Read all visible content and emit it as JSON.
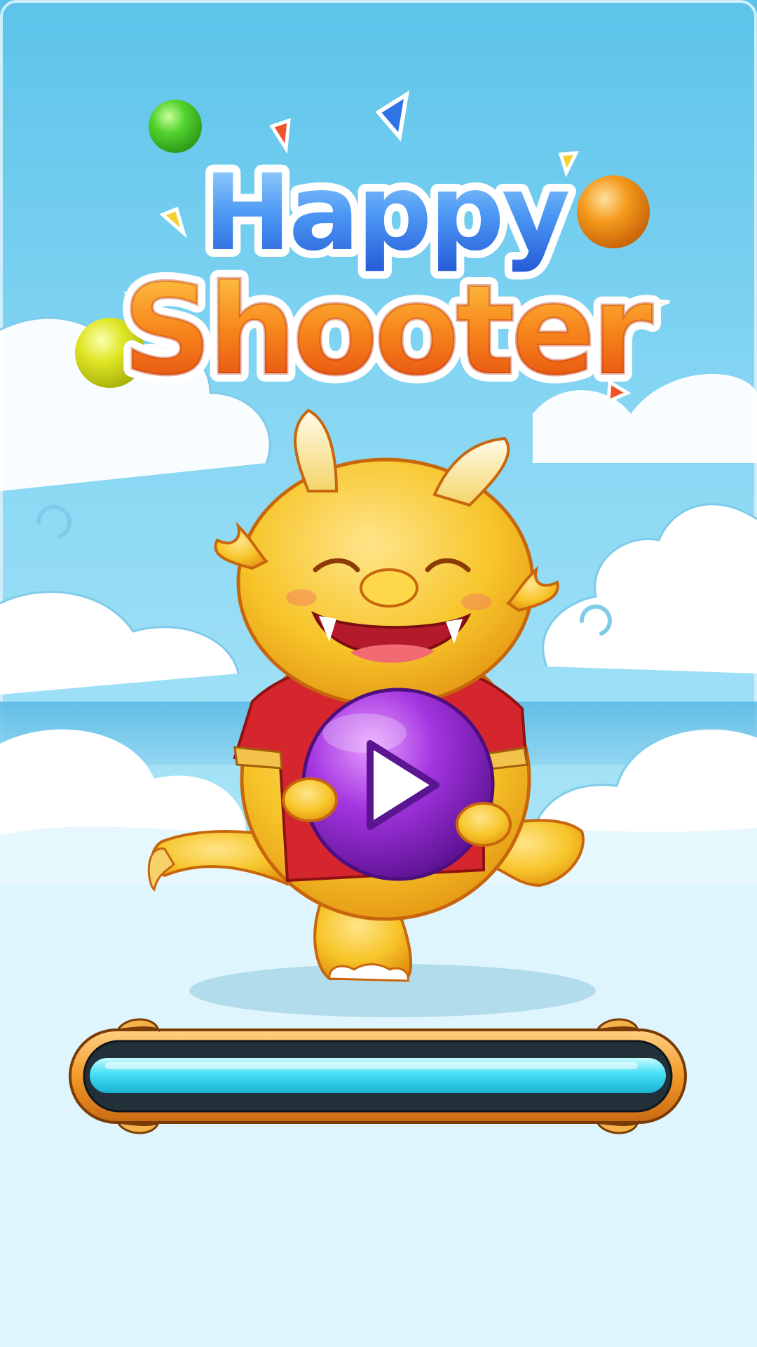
{
  "game": {
    "title_line1": "Happy",
    "title_line2": "Shooter",
    "play_icon": "play-icon",
    "loading_progress": 1.0
  },
  "colors": {
    "sky_top": "#5cc3ea",
    "title_happy": "#3d8ff0",
    "title_shooter": "#f26a12",
    "bubble_green": "#4fcf2c",
    "bubble_orange": "#f39a18",
    "bubble_yellow": "#d8e620",
    "dragon_body": "#f6c226",
    "dragon_shirt": "#d5262e",
    "play_bubble": "#9b2fd6",
    "bar_frame": "#f19a2e",
    "bar_fill": "#3fdcf2"
  }
}
